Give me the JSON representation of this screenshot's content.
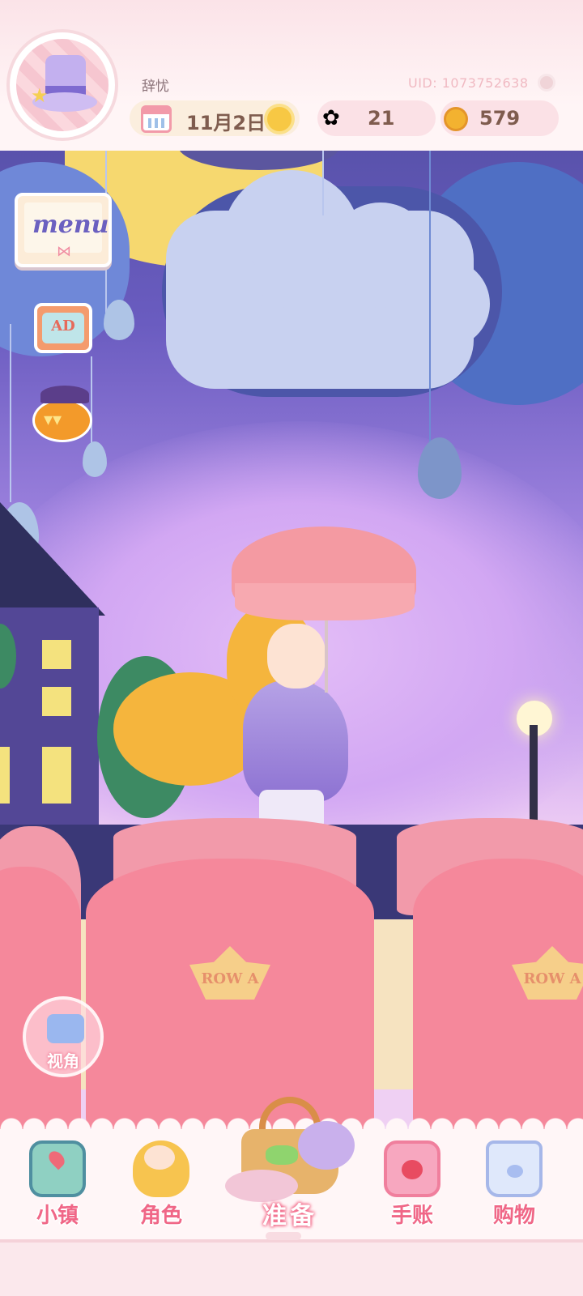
{
  "header": {
    "username": "辞忧",
    "uid": "UID: 1073752638",
    "date": "11月2日",
    "gems": "21",
    "coins": "579",
    "icons": {
      "avatar": "top-hat-avatar",
      "calendar": "calendar-icon",
      "weather": "sun-icon",
      "gem": "rainbow-flower-icon",
      "coin": "gold-coin-icon"
    }
  },
  "side_buttons": {
    "menu_label": "menu",
    "ad_label": "AD",
    "event_icon": "halloween-pumpkin-icon",
    "camera_label": "视角"
  },
  "scene": {
    "seat_badge_text": "ROW A",
    "colors": {
      "sky_top": "#4b4a9a",
      "sky_bottom": "#efd0f3",
      "seat": "#f5889b",
      "accent_pink": "#f06787"
    }
  },
  "nav": {
    "items": [
      {
        "label": "小镇",
        "icon": "town-map-icon"
      },
      {
        "label": "角色",
        "icon": "character-icon"
      },
      {
        "label": "准备",
        "icon": "picnic-basket-icon"
      },
      {
        "label": "手账",
        "icon": "journal-icon"
      },
      {
        "label": "购物",
        "icon": "shopping-bag-icon"
      }
    ]
  }
}
